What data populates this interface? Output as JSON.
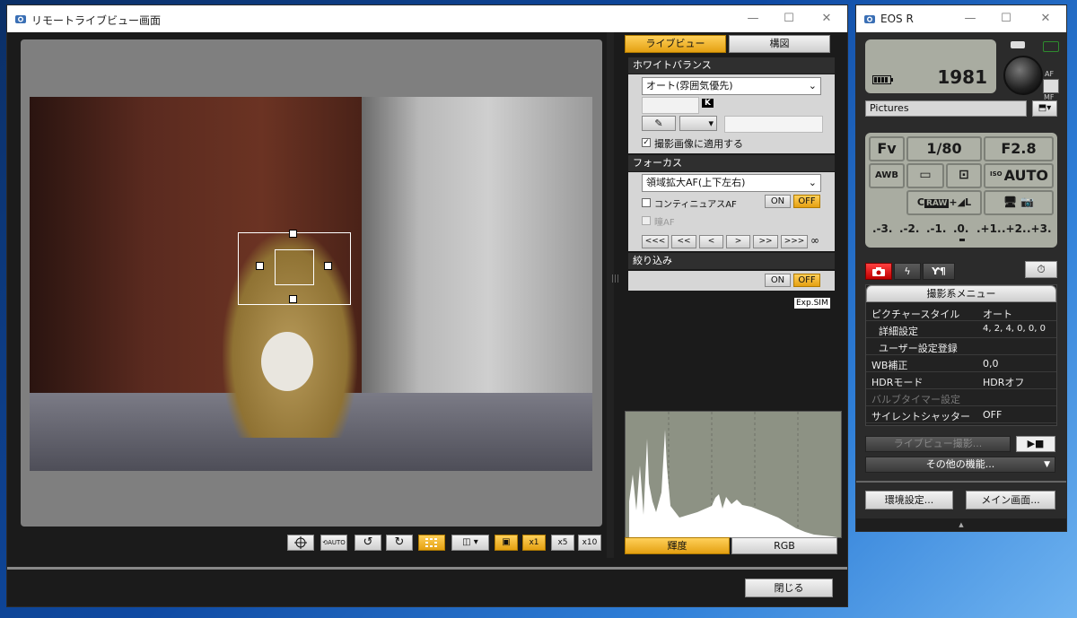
{
  "liveview_window": {
    "title": "リモートライブビュー画面",
    "tabs": [
      {
        "label": "ライブビュー",
        "active": true
      },
      {
        "label": "構図",
        "active": false
      }
    ],
    "white_balance": {
      "section": "ホワイトバランス",
      "mode": "オート(雰囲気優先)",
      "kelvin_unit": "K",
      "apply_label": "撮影画像に適用する",
      "apply_checked": true
    },
    "focus": {
      "section": "フォーカス",
      "mode": "領域拡大AF(上下左右)",
      "continuous_label": "コンティニュアスAF",
      "on": "ON",
      "off": "OFF",
      "eye_af_label": "瞳AF",
      "nav": [
        "<<<",
        "<<",
        "<",
        ">",
        ">>",
        ">>>"
      ],
      "infinity": "∞"
    },
    "aperture": {
      "section": "絞り込み",
      "on": "ON",
      "off": "OFF",
      "expsim": "Exp.SIM"
    },
    "histogram": {
      "tabs": [
        "輝度",
        "RGB"
      ],
      "active": "輝度"
    },
    "toolbar": {
      "x1": "x1",
      "x5": "x5",
      "x10": "x10",
      "auto": "AUTO"
    },
    "close_label": "閉じる"
  },
  "eos_window": {
    "title": "EOS R",
    "shots_remaining": "1981",
    "af_label": "AF",
    "mf_label": "MF",
    "folder": "Pictures",
    "mode": "Fv",
    "shutter": "1/80",
    "aperture": "F2.8",
    "awb": "AWB",
    "iso_label": "ISO",
    "iso": "AUTO",
    "quality_c": "C",
    "quality_raw": "RAW",
    "quality_plus": "+",
    "quality_l": "L",
    "exposure_scale": [
      ".-3.",
      ".-2.",
      ".-1.",
      ".0.",
      ".+1.",
      ".+2.",
      ".+3."
    ],
    "menu_title": "撮影系メニュー",
    "menu": [
      {
        "label": "ピクチャースタイル",
        "value": "オート",
        "disabled": false
      },
      {
        "label": "詳細設定",
        "value": "4, 2, 4, 0, 0, 0",
        "disabled": false
      },
      {
        "label": "ユーザー設定登録",
        "value": "",
        "disabled": false
      },
      {
        "label": "WB補正",
        "value": "0,0",
        "disabled": false
      },
      {
        "label": "HDRモード",
        "value": "HDRオフ",
        "disabled": false
      },
      {
        "label": "バルブタイマー設定",
        "value": "",
        "disabled": true
      },
      {
        "label": "サイレントシャッター",
        "value": "OFF",
        "disabled": false
      }
    ],
    "liveview_shoot": "ライブビュー撮影...",
    "other_functions": "その他の機能...",
    "prefs": "環境設定...",
    "main_window": "メイン画面..."
  },
  "colors": {
    "accent": "#f0b429",
    "lcd": "#a9aca1",
    "panel": "#1b1b1b"
  }
}
